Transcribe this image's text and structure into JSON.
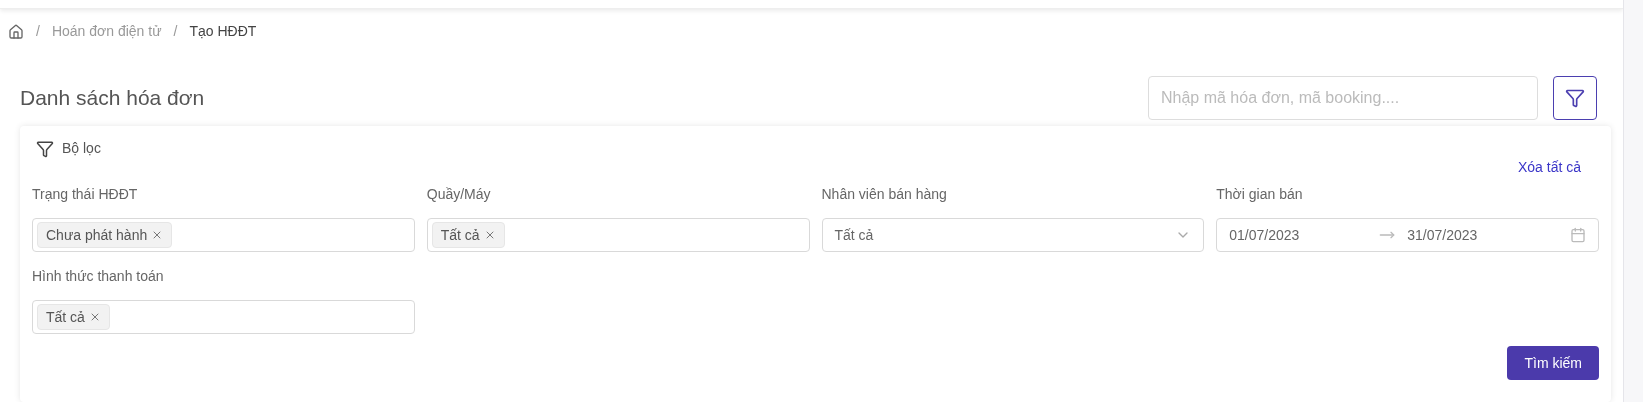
{
  "breadcrumb_separator": "/",
  "breadcrumb": [
    {
      "label": "Hoán đơn điện tử",
      "current": false
    },
    {
      "label": "Tạo HĐĐT",
      "current": true
    }
  ],
  "title": "Danh sách hóa đơn",
  "search": {
    "placeholder": "Nhập mã hóa đơn, mã booking...."
  },
  "filter_panel": {
    "title": "Bộ lọc",
    "clear_all": "Xóa tất cả",
    "fields": [
      {
        "kind": "tags",
        "label": "Trạng thái HĐĐT",
        "tags": [
          "Chưa phát hành"
        ]
      },
      {
        "kind": "tags",
        "label": "Quầy/Máy",
        "tags": [
          "Tất cả"
        ]
      },
      {
        "kind": "select",
        "label": "Nhân viên bán hàng",
        "value": "Tất cả"
      },
      {
        "kind": "daterange",
        "label": "Thời gian bán",
        "from": "01/07/2023",
        "to": "31/07/2023"
      },
      {
        "kind": "tags",
        "label": "Hình thức thanh toán",
        "tags": [
          "Tất cả"
        ]
      }
    ],
    "search_button": "Tìm kiếm"
  }
}
